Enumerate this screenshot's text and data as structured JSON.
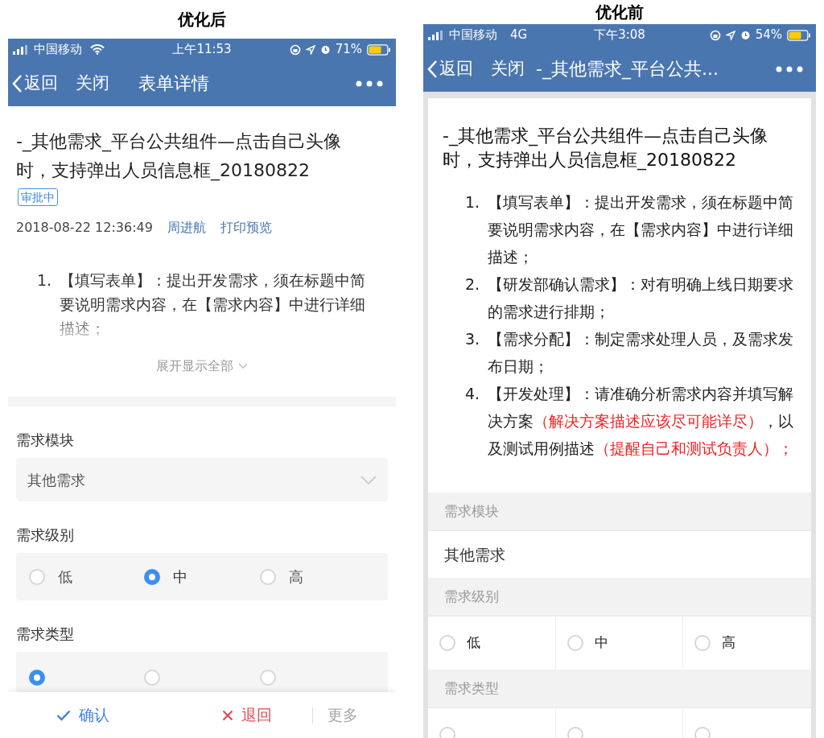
{
  "after": {
    "heading": "优化后",
    "status": {
      "carrier": "中国移动",
      "network": {
        "kind": "wifi"
      },
      "time": "上午11:53",
      "battery": "71%"
    },
    "nav": {
      "back": "返回",
      "close": "关闭",
      "title": "表单详情"
    },
    "title": "-_其他需求_平台公共组件—点击自己头像时，支持弹出人员信息框_20180822",
    "badge": "审批中",
    "meta": {
      "datetime": "2018-08-22 12:36:49",
      "author": "周进航",
      "print": "打印预览"
    },
    "steps": [
      {
        "number": "1.",
        "segments": [
          {
            "text": "【填写表单】：提出开发需求，须在标题中简要说明需求内容，在【需求内容】中进行详细描述；",
            "emphasis": false
          }
        ]
      }
    ],
    "expand": "展开显示全部",
    "fields": [
      {
        "kind": "select",
        "label": "需求模块",
        "value": "其他需求"
      },
      {
        "kind": "radio",
        "label": "需求级别",
        "options": [
          {
            "label": "低",
            "selected": false
          },
          {
            "label": "中",
            "selected": true
          },
          {
            "label": "高",
            "selected": false
          }
        ]
      },
      {
        "kind": "radio",
        "label": "需求类型",
        "options": [
          {
            "selected": true
          },
          {
            "selected": false
          },
          {
            "selected": false
          }
        ]
      }
    ],
    "actions": [
      {
        "kind": "confirm",
        "label": "确认"
      },
      {
        "kind": "reject",
        "label": "退回"
      },
      {
        "kind": "more",
        "label": "更多"
      }
    ]
  },
  "before": {
    "heading": "优化前",
    "status": {
      "carrier": "中国移动",
      "network": {
        "kind": "text",
        "label": "4G"
      },
      "time": "下午3:08",
      "battery": "54%"
    },
    "nav": {
      "back": "返回",
      "close": "关闭",
      "title": "-_其他需求_平台公共..."
    },
    "title": "-_其他需求_平台公共组件—点击自己头像时，支持弹出人员信息框_20180822",
    "steps": [
      {
        "number": "1.",
        "segments": [
          {
            "text": "【填写表单】：提出开发需求，须在标题中简要说明需求内容，在【需求内容】中进行详细描述；",
            "emphasis": false
          }
        ]
      },
      {
        "number": "2.",
        "segments": [
          {
            "text": "【研发部确认需求】：对有明确上线日期要求的需求进行排期；",
            "emphasis": false
          }
        ]
      },
      {
        "number": "3.",
        "segments": [
          {
            "text": "【需求分配】：制定需求处理人员，及需求发布日期；",
            "emphasis": false
          }
        ]
      },
      {
        "number": "4.",
        "segments": [
          {
            "text": "【开发处理】：请准确分析需求内容并填写解决方案",
            "emphasis": false
          },
          {
            "text": "（解决方案描述应该尽可能详尽）",
            "emphasis": true
          },
          {
            "text": "，以及测试用例描述",
            "emphasis": false
          },
          {
            "text": "（提醒自己和测试负责人）；",
            "emphasis": true
          }
        ]
      }
    ],
    "fields": [
      {
        "kind": "select",
        "label": "需求模块",
        "value": "其他需求"
      },
      {
        "kind": "radio",
        "label": "需求级别",
        "options": [
          {
            "label": "低",
            "selected": false
          },
          {
            "label": "中",
            "selected": false
          },
          {
            "label": "高",
            "selected": false
          }
        ]
      },
      {
        "kind": "radio",
        "label": "需求类型",
        "options": [
          {
            "selected": false
          },
          {
            "selected": false
          },
          {
            "selected": false
          }
        ]
      }
    ]
  }
}
